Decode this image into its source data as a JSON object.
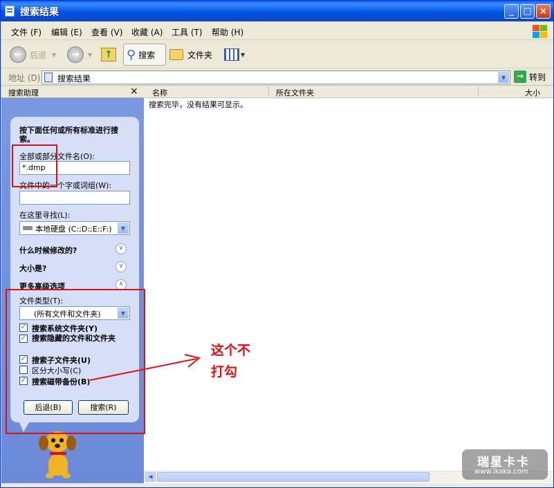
{
  "window": {
    "title": "搜索结果",
    "controls": [
      "_",
      "□",
      "×"
    ]
  },
  "menu": [
    "文件 (F)",
    "编辑 (E)",
    "查看 (V)",
    "收藏 (A)",
    "工具 (T)",
    "帮助 (H)"
  ],
  "toolbar": {
    "back": "后退",
    "search": "搜索",
    "folders": "文件夹"
  },
  "address": {
    "label": "地址 (D)",
    "value": "搜索结果",
    "go": "转到"
  },
  "pane": {
    "title": "搜索助理",
    "close": "×",
    "prompt": "按下面任何或所有标准进行搜索。",
    "filename_label": "全部或部分文件名(O):",
    "filename_value": "*.dmp",
    "word_label": "文件中的一个字或词组(W):",
    "word_value": "",
    "lookin_label": "在这里寻找(L):",
    "lookin_value": "本地硬盘 (C:;D:;E:;F:)",
    "when_modified": "什么时候修改的?",
    "size": "大小是?",
    "advanced": "更多高级选项",
    "filetype_label": "文件类型(T):",
    "filetype_value": "(所有文件和文件夹)",
    "checkboxes": [
      {
        "label": "搜索系统文件夹(Y)",
        "checked": true
      },
      {
        "label": "搜索隐藏的文件和文件夹",
        "checked": true
      },
      {
        "label": "搜索子文件夹(U)",
        "checked": true
      },
      {
        "label": "区分大小写(C)",
        "checked": false
      },
      {
        "label": "搜索磁带备份(B)",
        "checked": true
      }
    ],
    "back_button": "后退(B)",
    "search_button": "搜索(R)"
  },
  "results": {
    "columns": [
      "名称",
      "所在文件夹",
      "大小"
    ],
    "message": "搜索完毕，没有结果可显示。"
  },
  "annotation": {
    "line1": "这个不",
    "line2": "打勾",
    "color": "#e01010"
  },
  "watermark": {
    "brand": "瑞星卡卡",
    "url": "www.ikaka.com"
  }
}
